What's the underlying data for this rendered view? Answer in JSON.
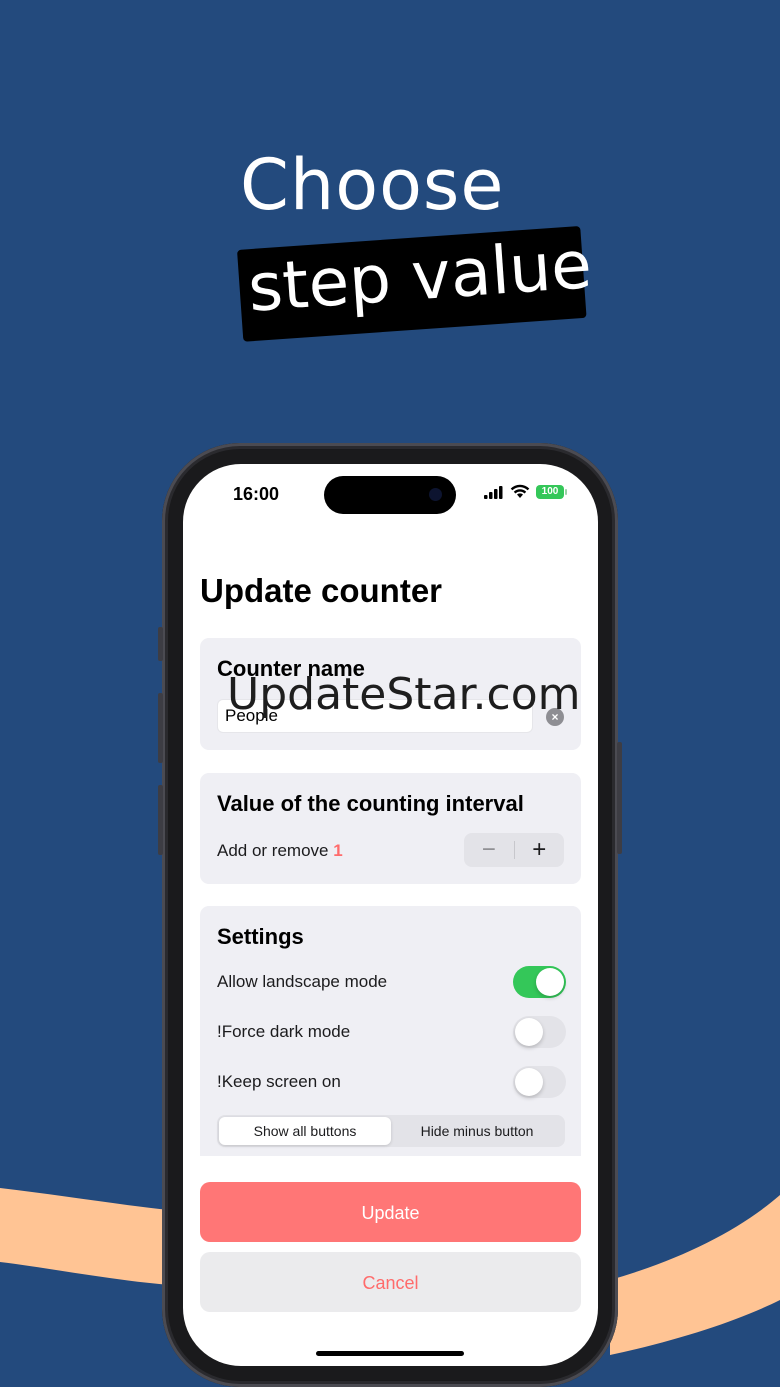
{
  "promo": {
    "line1": "Choose",
    "line2": "step value"
  },
  "status_bar": {
    "time": "16:00",
    "battery": "100"
  },
  "page": {
    "title": "Update counter"
  },
  "counter_name": {
    "title": "Counter name",
    "value": "People",
    "clear_icon": "×"
  },
  "watermark": "UpdateStar.com",
  "interval": {
    "title": "Value of the counting interval",
    "label": "Add or remove",
    "step": "1",
    "minus": "−",
    "plus": "+"
  },
  "settings": {
    "title": "Settings",
    "items": [
      {
        "label": "Allow landscape mode",
        "on": true
      },
      {
        "label": "!Force dark mode",
        "on": false
      },
      {
        "label": "!Keep screen on",
        "on": false
      }
    ],
    "segments": [
      "Show all buttons",
      "Hide minus button"
    ],
    "selected_segment": "Show all buttons"
  },
  "actions": {
    "primary": "Update",
    "secondary": "Cancel"
  },
  "colors": {
    "background": "#234a7d",
    "accent": "#ff7676",
    "toggle_on": "#34c759",
    "ribbon": "#ffc494"
  }
}
